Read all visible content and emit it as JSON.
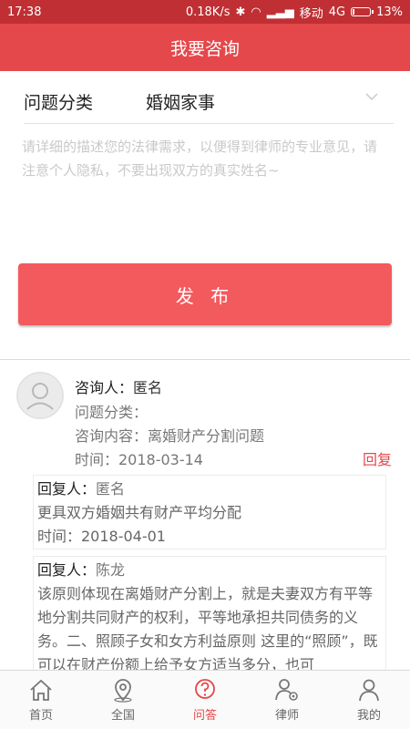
{
  "status": {
    "time": "17:38",
    "speed": "0.18K/s",
    "carrier": "移动",
    "network": "4G",
    "battery": "13%",
    "battery_level": 0.13
  },
  "appbar": {
    "title": "我要咨询"
  },
  "form": {
    "category_label": "问题分类",
    "category_value": "婚姻家事",
    "description_placeholder": "请详细的描述您的法律需求，以便得到律师的专业意见，请注意个人隐私，不要出现双方的真实姓名~",
    "publish_label": "发 布"
  },
  "question": {
    "asker_key": "咨询人：",
    "asker_value": "匿名",
    "category_line": "问题分类：",
    "content_line": "咨询内容：离婚财产分割问题",
    "time_line": "时间：2018-03-14",
    "reply_label": "回复"
  },
  "replies": [
    {
      "head_key": "回复人：",
      "head_value": "匿名",
      "body": "更具双方婚姻共有财产平均分配",
      "time": "时间：2018-04-01"
    },
    {
      "head_key": "回复人：",
      "head_value": "陈龙",
      "body": "该原则体现在离婚财产分割上，就是夫妻双方有平等地分割共同财产的权利，平等地承担共同债务的义务。二、照顾子女和女方利益原则 这里的“照顾”，既可以在财产份额上给予女方适当多分，也可"
    }
  ],
  "tabbar": {
    "items": [
      {
        "label": "首页",
        "icon": "home-icon"
      },
      {
        "label": "全国",
        "icon": "location-icon"
      },
      {
        "label": "问答",
        "icon": "qa-icon",
        "active": true
      },
      {
        "label": "律师",
        "icon": "lawyer-icon"
      },
      {
        "label": "我的",
        "icon": "user-icon"
      }
    ]
  },
  "colors": {
    "primary": "#e5484b",
    "statusbar": "#bf2f33",
    "button": "#f35a5d"
  }
}
